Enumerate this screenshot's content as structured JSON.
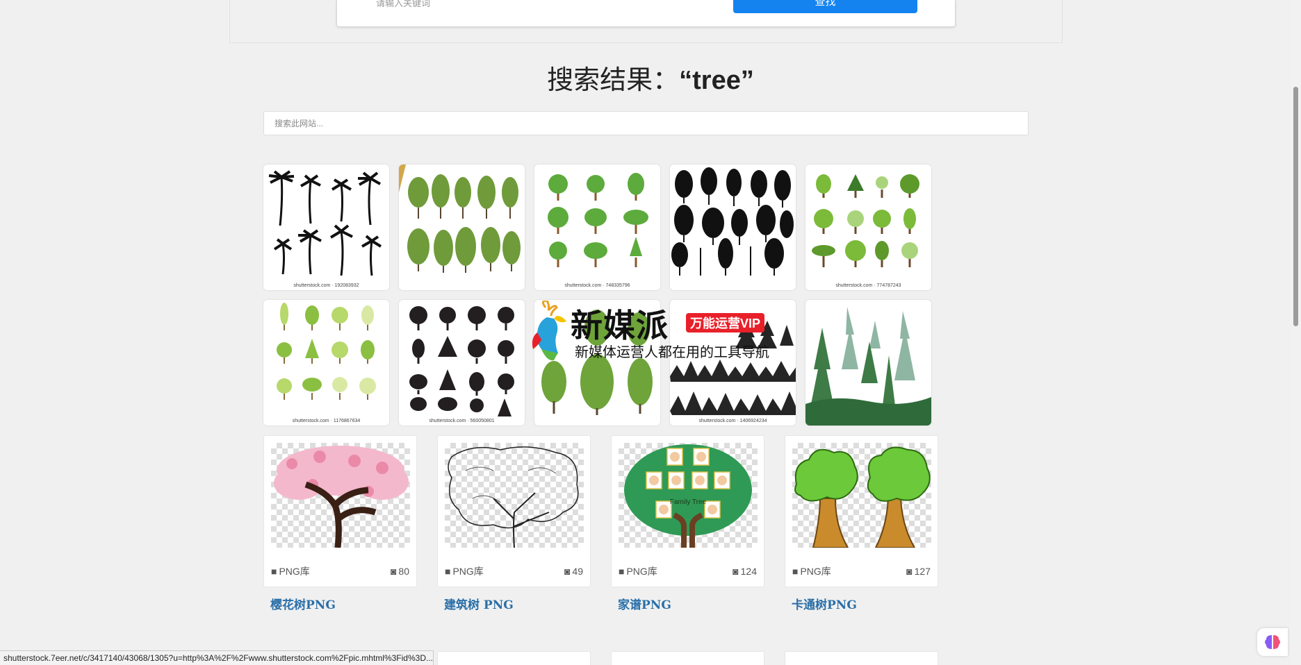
{
  "top": {
    "input_hint": "请输入关键词",
    "button_label": "查找"
  },
  "result_heading": {
    "prefix": "搜索结果：",
    "query": "“tree”"
  },
  "site_search": {
    "placeholder": "搜索此网站..."
  },
  "thumbnails": [
    {
      "watermark": "shutterstock.com · 192083932",
      "icon": "palm-trees-silhouette"
    },
    {
      "watermark": "",
      "icon": "willow-trees"
    },
    {
      "watermark": "shutterstock.com · 748335796",
      "icon": "cartoon-green-trees"
    },
    {
      "watermark": "",
      "icon": "black-tree-silhouettes"
    },
    {
      "watermark": "shutterstock.com · 774787243",
      "icon": "flat-green-trees"
    },
    {
      "watermark": "shutterstock.com · 1176867634",
      "icon": "light-green-trees"
    },
    {
      "watermark": "shutterstock.com · 560050801",
      "icon": "dark-tree-icons"
    },
    {
      "watermark": "",
      "icon": "realistic-trees"
    },
    {
      "watermark": "shutterstock.com · 1406924234",
      "icon": "pine-forest-silhouette"
    },
    {
      "watermark": "",
      "icon": "forest-scene"
    }
  ],
  "overlay": {
    "brand": "新媒派",
    "vip": "万能运营VIP",
    "tagline": "新媒体运营人都在用的工具导航"
  },
  "cards": [
    {
      "category": "PNG库",
      "count": "80",
      "title": "樱花树PNG"
    },
    {
      "category": "PNG库",
      "count": "49",
      "title": "建筑树 PNG"
    },
    {
      "category": "PNG库",
      "count": "124",
      "title": "家谱PNG"
    },
    {
      "category": "PNG库",
      "count": "127",
      "title": "卡通树PNG"
    }
  ],
  "family_tree_label": "Family Tree",
  "status_url": "shutterstock.7eer.net/c/3417140/43068/1305?u=http%3A%2F%2Fwww.shutterstock.com%2Fpic.mhtml%3Fid%3D..."
}
